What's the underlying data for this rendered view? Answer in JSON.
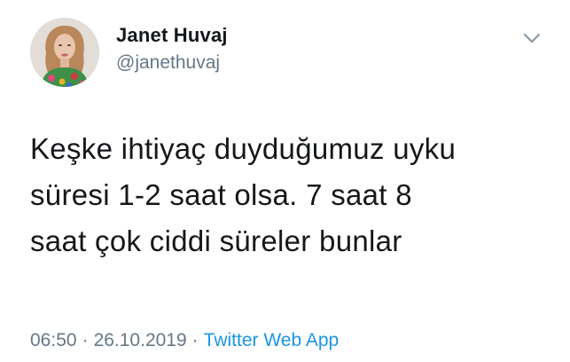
{
  "user": {
    "display_name": "Janet Huvaj",
    "handle": "@janethuvaj",
    "avatar_icon": "profile-photo"
  },
  "tweet": {
    "text": "Keşke ihtiyaç duyduğumuz uyku\nsüresi 1-2 saat olsa. 7 saat 8\nsaat çok ciddi süreler bunlar"
  },
  "meta": {
    "time": "06:50",
    "separator": "·",
    "date": "26.10.2019",
    "source": "Twitter Web App"
  },
  "menu_icon": "chevron-down-icon",
  "colors": {
    "text": "#14171a",
    "secondary": "#657786",
    "link": "#1b95e0"
  }
}
